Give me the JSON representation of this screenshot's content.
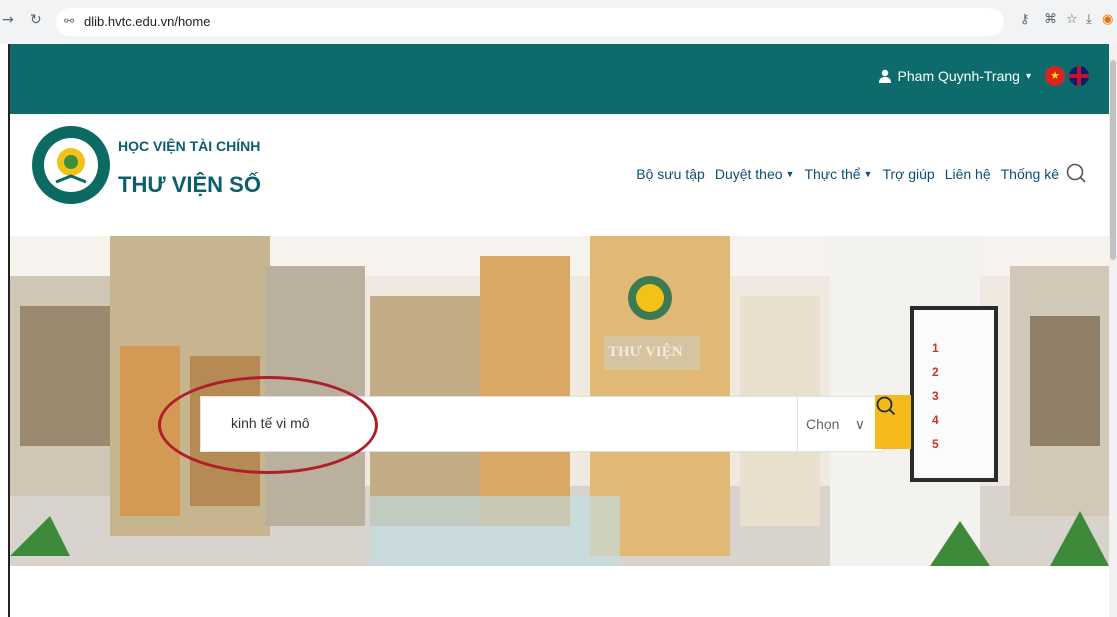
{
  "browser": {
    "url": "dlib.hvtc.edu.vn/home",
    "icons": [
      "forward-icon",
      "reload-icon",
      "site-info-icon",
      "password-key-icon",
      "translate-icon",
      "star-icon",
      "download-icon",
      "profile-icon",
      "menu-dots-icon"
    ]
  },
  "topbar": {
    "user_name": "Pham Quynh-Trang",
    "user_caret": "▾"
  },
  "header": {
    "org_name": "HỌC VIỆN TÀI CHÍNH",
    "library_name": "THƯ VIỆN SỐ",
    "menu": [
      {
        "label": "Bộ sưu tập",
        "dropdown": false
      },
      {
        "label": "Duyệt theo",
        "dropdown": true
      },
      {
        "label": "Thực thể",
        "dropdown": true
      },
      {
        "label": "Trợ giúp",
        "dropdown": false
      },
      {
        "label": "Liên hệ",
        "dropdown": false
      },
      {
        "label": "Thống kê",
        "dropdown": false
      }
    ]
  },
  "hero": {
    "search_value": "kinh tế vi mô",
    "select_label": "Chọn",
    "select_caret": "∨",
    "wall_sign": "THƯ VIỆN",
    "board_numbers": [
      "1",
      "2",
      "3",
      "4",
      "5"
    ]
  },
  "colors": {
    "topbar": "#0d6b6b",
    "brand_text": "#0b5e6b",
    "search_button": "#f3ba19",
    "annotation_circle": "#b01e2a"
  }
}
